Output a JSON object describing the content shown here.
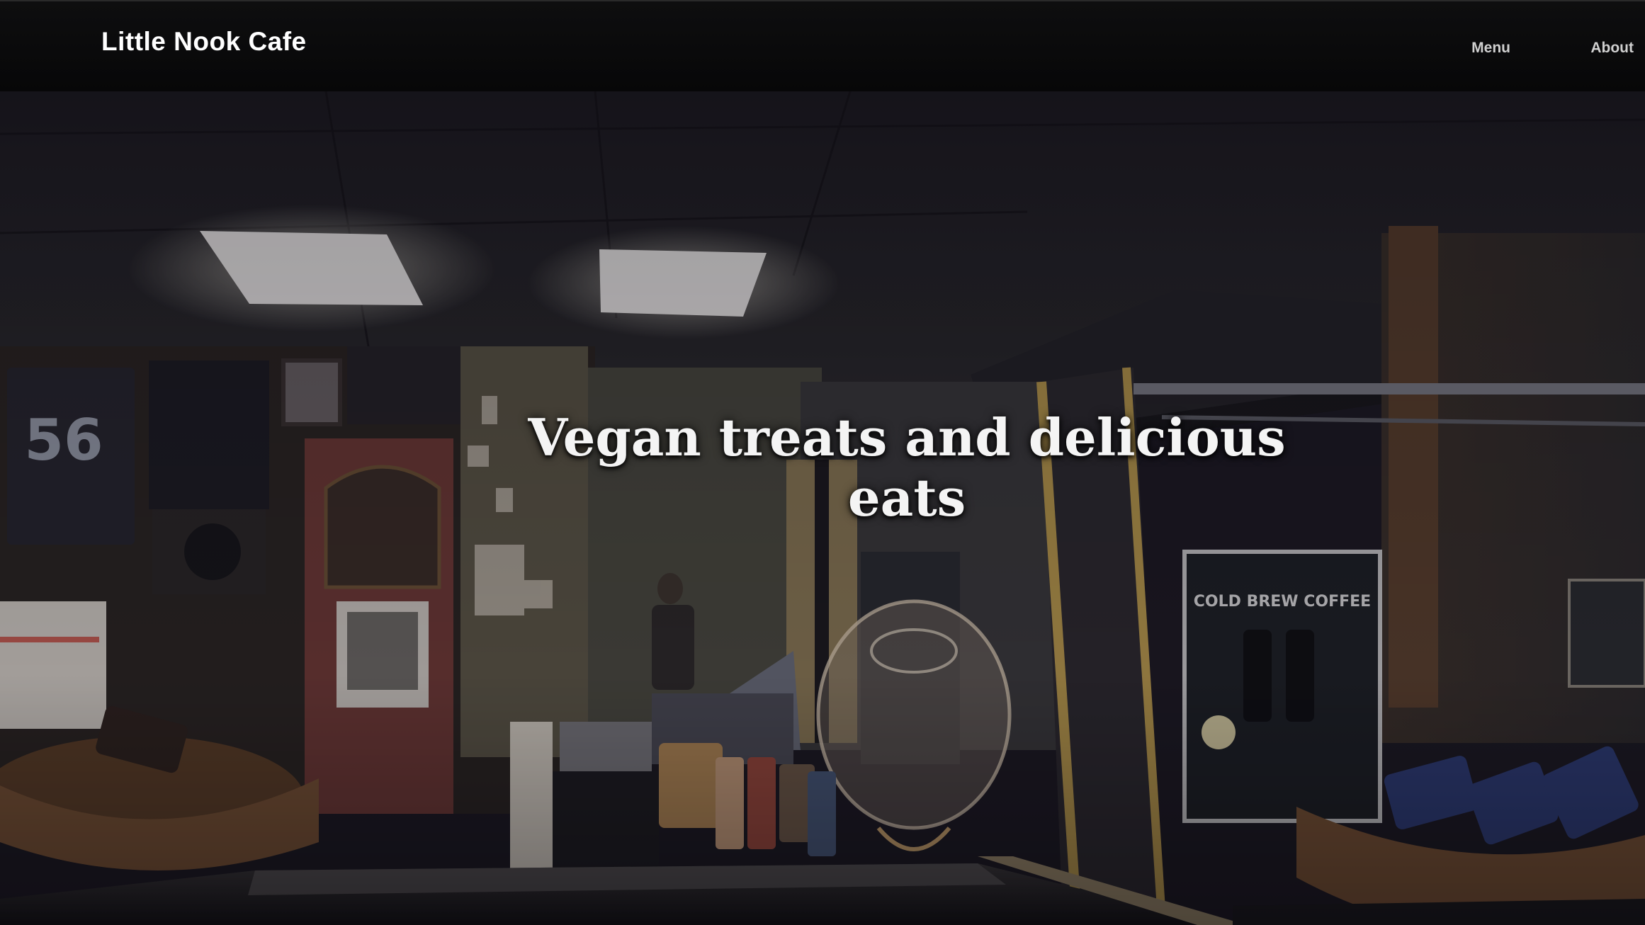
{
  "navbar": {
    "brand": "Little Nook Cafe",
    "links": [
      {
        "label": "Menu"
      },
      {
        "label": "About"
      }
    ]
  },
  "hero": {
    "heading": "Vegan treats and delicious eats",
    "coffee_sign_text": "COLD BREW COFFEE",
    "jersey_number": "56"
  },
  "colors": {
    "navbar_bg": "#0b0b0c",
    "brand_text": "#ffffff",
    "nav_link_text": "#d0d0d0",
    "heading_text": "#f4f4f4"
  }
}
